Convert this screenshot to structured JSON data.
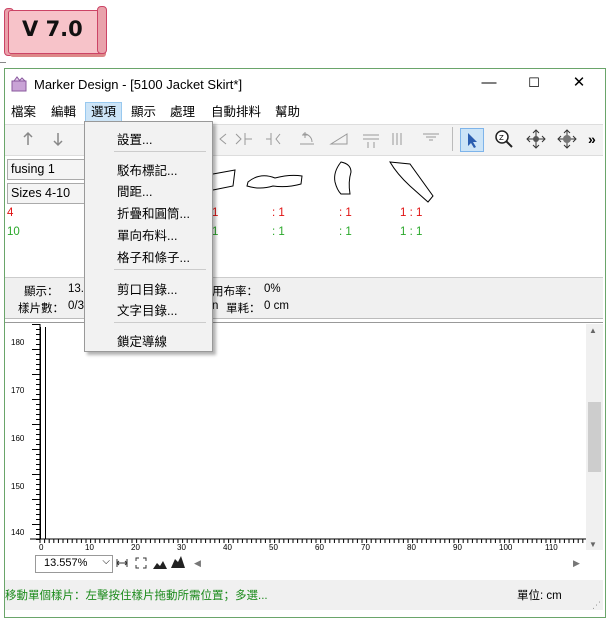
{
  "badge": {
    "text": "V 7.0"
  },
  "window": {
    "title": "Marker Design - [5100 Jacket Skirt*]",
    "minimize": "—",
    "maximize": "☐",
    "close": "✕"
  },
  "menubar": [
    "檔案",
    "編輯",
    "選項",
    "顯示",
    "處理",
    "自動排料",
    "幫助"
  ],
  "dropdown": {
    "items": [
      "設置...",
      "駁布標記...",
      "間距...",
      "折疊和圓筒...",
      "單向布料...",
      "格子和條子...",
      "剪口目錄...",
      "文字目錄...",
      "鎖定導線"
    ]
  },
  "left_panel": {
    "fabric": "fusing 1",
    "sizes": "Sizes 4-10",
    "count_red": "4",
    "count_green": "10"
  },
  "piece_ratios": {
    "red": [
      "1",
      ": 1",
      ": 1",
      "1 : 1"
    ],
    "green": [
      "1",
      ": 1",
      ": 1",
      "1 : 1"
    ]
  },
  "info": {
    "display_label": "顯示：",
    "display_value": "13.",
    "pieces_label": "樣片數：",
    "pieces_value": "0/3",
    "usage_label": "用布率：",
    "usage_value": "0%",
    "unit_fragment": "n",
    "consumption_label": "單耗：",
    "consumption_value": "0 cm"
  },
  "vertical_ruler": [
    "180",
    "170",
    "160",
    "150",
    "140"
  ],
  "horizontal_ruler": [
    "0",
    "10",
    "20",
    "30",
    "40",
    "50",
    "60",
    "70",
    "80",
    "90",
    "100",
    "110"
  ],
  "zoom": {
    "value": "13.557%"
  },
  "status": {
    "message": "移動單個樣片：左擊按住樣片拖動所需位置；多選...",
    "unit": "單位: cm"
  },
  "colors": {
    "red": "#e01010",
    "green": "#2aa82a",
    "status_green": "#1a8a1a",
    "accent": "#cce4f7"
  }
}
